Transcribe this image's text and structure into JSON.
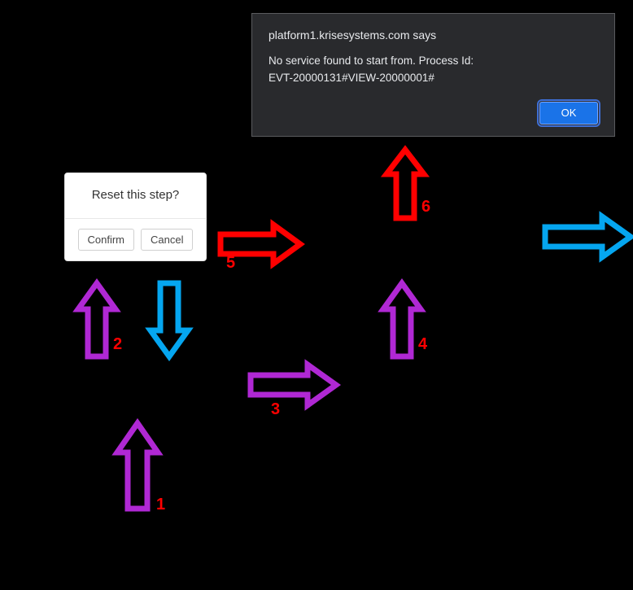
{
  "alert": {
    "title": "platform1.krisesystems.com says",
    "message_line1": "No service found to start from. Process Id:",
    "message_line2": "EVT-20000131#VIEW-20000001#",
    "ok_label": "OK"
  },
  "popover": {
    "title": "Reset this step?",
    "confirm_label": "Confirm",
    "cancel_label": "Cancel"
  },
  "arrows": {
    "a1": {
      "number": "1"
    },
    "a2": {
      "number": "2"
    },
    "a3": {
      "number": "3"
    },
    "a4": {
      "number": "4"
    },
    "a5": {
      "number": "5"
    },
    "a6": {
      "number": "6"
    }
  },
  "colors": {
    "purple": "#b028d4",
    "blue": "#05a6f0",
    "red": "#ff0000"
  }
}
